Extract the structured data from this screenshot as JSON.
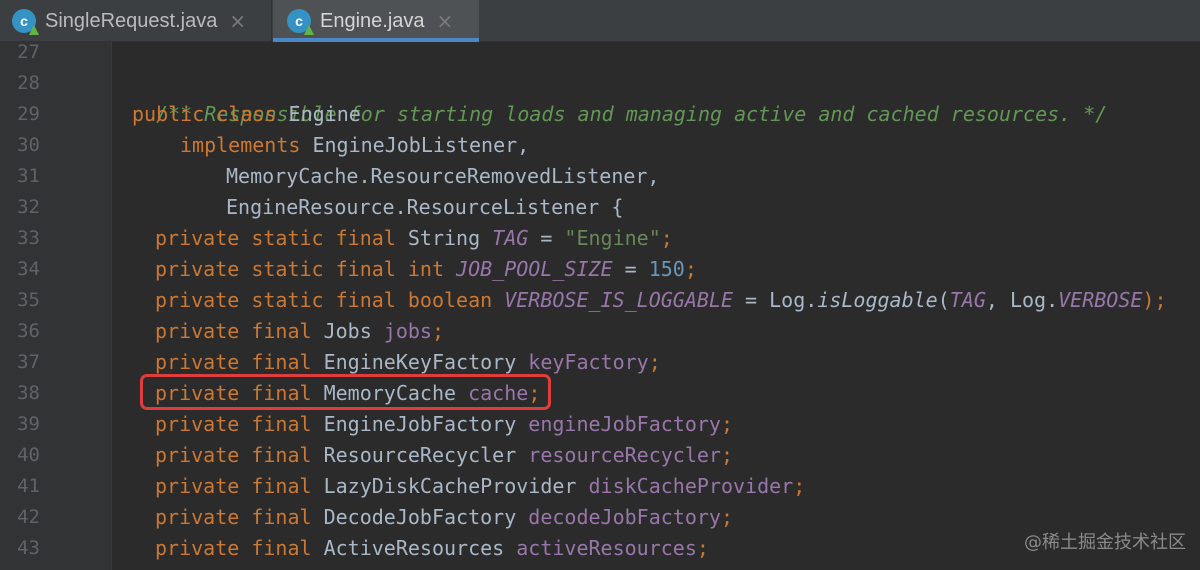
{
  "tabs": [
    {
      "label": "SingleRequest.java",
      "icon": "java-class-icon",
      "active": false
    },
    {
      "label": "Engine.java",
      "icon": "java-class-icon",
      "active": true
    }
  ],
  "tab_close_glyph": "×",
  "file_icon_letter": "c",
  "line_numbers": [
    "27",
    "28",
    "29",
    "30",
    "31",
    "32",
    "33",
    "34",
    "35",
    "36",
    "37",
    "38",
    "39",
    "40",
    "41",
    "42",
    "43"
  ],
  "code": {
    "l28": {
      "comment": "/** Responsible for starting loads and managing active and cached resources. */"
    },
    "l29": {
      "kw": "public class",
      "name": " Engine"
    },
    "l30": {
      "kw": "implements",
      "name": " EngineJobListener,"
    },
    "l31": {
      "name": "MemoryCache.ResourceRemovedListener,"
    },
    "l32": {
      "name": "EngineResource.ResourceListener {"
    },
    "l33": {
      "kw": "private static final",
      "type": " String ",
      "field": "TAG",
      "eq": " = ",
      "str": "\"Engine\"",
      "end": ";"
    },
    "l34": {
      "kw": "private static final int",
      "sp": " ",
      "field": "JOB_POOL_SIZE",
      "eq": " = ",
      "num": "150",
      "end": ";"
    },
    "l35": {
      "kw": "private static final boolean",
      "sp": " ",
      "field": "VERBOSE_IS_LOGGABLE",
      "eq": " = Log.",
      "method": "isLoggable",
      "open": "(",
      "arg1": "TAG",
      "mid": ", Log.",
      "arg2": "VERBOSE",
      "end": ");"
    },
    "l36": {
      "kw": "private final",
      "type": " Jobs ",
      "field": "jobs",
      "end": ";"
    },
    "l37": {
      "kw": "private final",
      "type": " EngineKeyFactory ",
      "field": "keyFactory",
      "end": ";"
    },
    "l38": {
      "kw": "private final",
      "type": " MemoryCache ",
      "field": "cache",
      "end": ";"
    },
    "l39": {
      "kw": "private final",
      "type": " EngineJobFactory ",
      "field": "engineJobFactory",
      "end": ";"
    },
    "l40": {
      "kw": "private final",
      "type": " ResourceRecycler ",
      "field": "resourceRecycler",
      "end": ";"
    },
    "l41": {
      "kw": "private final",
      "type": " LazyDiskCacheProvider ",
      "field": "diskCacheProvider",
      "end": ";"
    },
    "l42": {
      "kw": "private final",
      "type": " DecodeJobFactory ",
      "field": "decodeJobFactory",
      "end": ";"
    },
    "l43": {
      "kw": "private final",
      "type": " ActiveResources ",
      "field": "activeResources",
      "end": ";"
    }
  },
  "watermark": "@稀土掘金技术社区",
  "colors": {
    "background": "#2b2b2b",
    "keyword": "#cc7832",
    "comment": "#629755",
    "field": "#9876aa",
    "string": "#6a8759",
    "number": "#6897bb",
    "highlight_box": "#e03c3c",
    "active_tab_underline": "#4a88c7"
  }
}
